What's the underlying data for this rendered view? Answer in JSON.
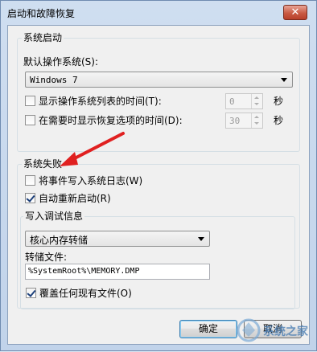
{
  "window": {
    "title": "启动和故障恢复",
    "close_glyph": "✕"
  },
  "system_startup": {
    "legend": "系统启动",
    "default_os_label": "默认操作系统(S):",
    "default_os_value": "Windows 7",
    "show_os_list_label": "显示操作系统列表的时间(T):",
    "show_os_list_checked": false,
    "show_os_list_value": "0",
    "show_recovery_label": "在需要时显示恢复选项的时间(D):",
    "show_recovery_checked": false,
    "show_recovery_value": "30",
    "seconds_unit": "秒"
  },
  "system_failure": {
    "legend": "系统失败",
    "write_event_label": "将事件写入系统日志(W)",
    "write_event_checked": false,
    "auto_restart_label": "自动重新启动(R)",
    "auto_restart_checked": true,
    "debug_info_legend": "写入调试信息",
    "debug_type_value": "核心内存转储",
    "dump_file_label": "转储文件:",
    "dump_file_value": "%SystemRoot%\\MEMORY.DMP",
    "overwrite_label": "覆盖任何现有文件(O)",
    "overwrite_checked": true
  },
  "buttons": {
    "ok_label": "确定",
    "cancel_label": "取消"
  },
  "annotation": {
    "color": "#e02020"
  },
  "watermark": {
    "text": "系统之家"
  }
}
